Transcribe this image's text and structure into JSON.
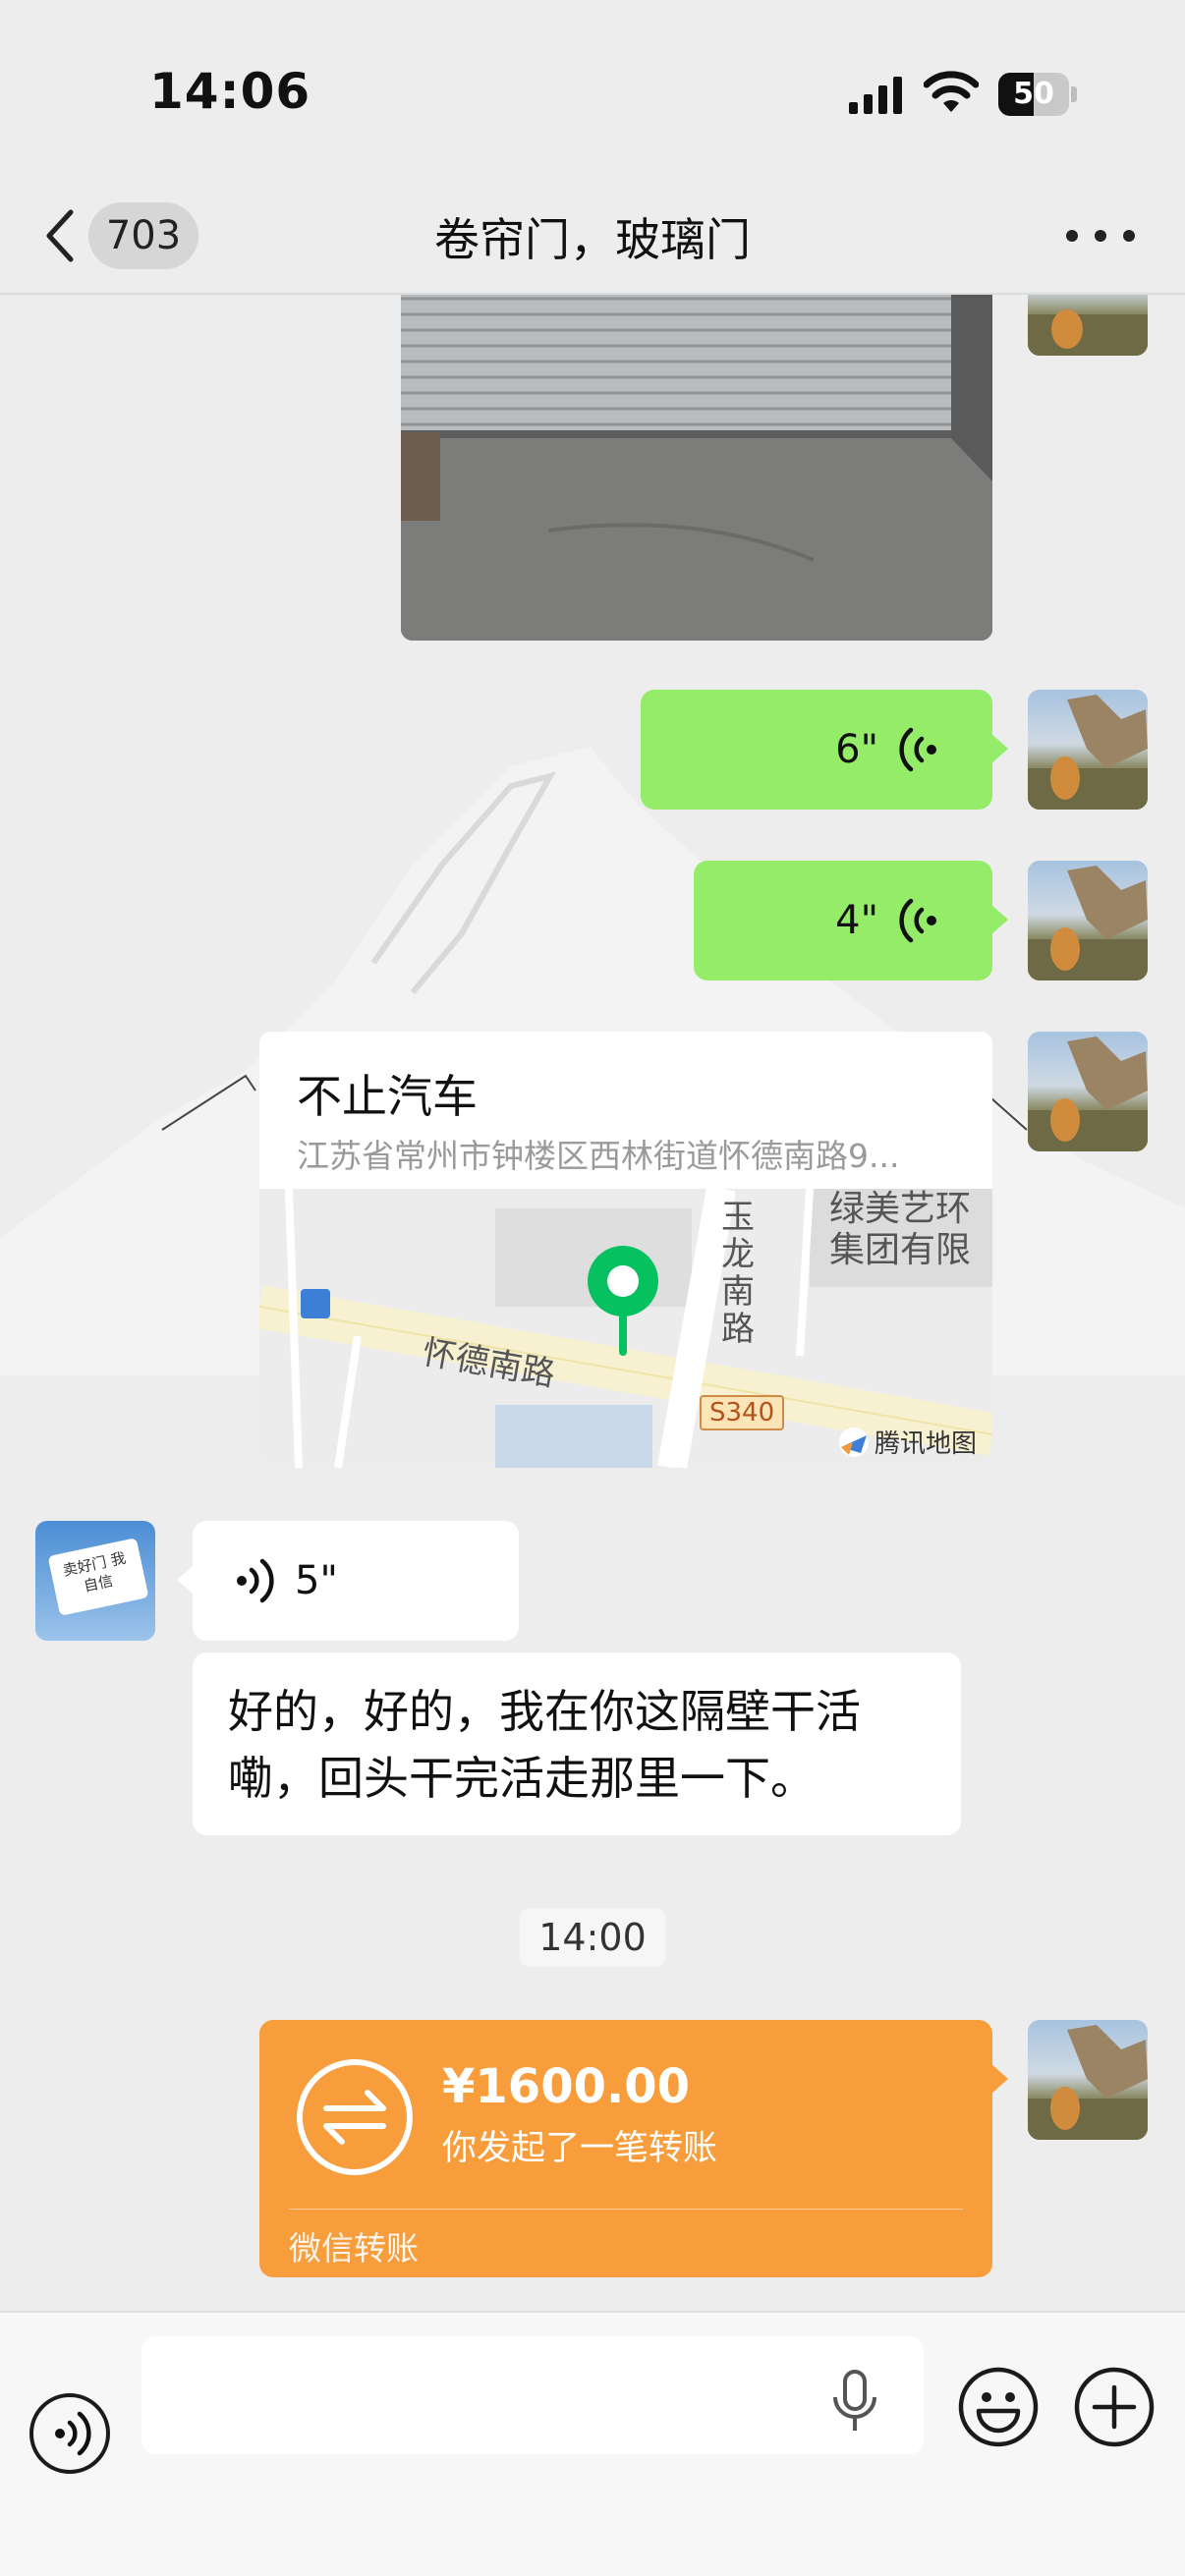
{
  "status_bar": {
    "time": "14:06",
    "battery_percent": "50",
    "battery_level": 0.5
  },
  "header": {
    "back_badge": "703",
    "title": "卷帘门，玻璃门"
  },
  "messages": [
    {
      "type": "image",
      "from": "me",
      "subject": "roller-shutter-door-photo"
    },
    {
      "type": "voice",
      "from": "me",
      "duration": "6\""
    },
    {
      "type": "voice",
      "from": "me",
      "duration": "4\""
    },
    {
      "type": "location",
      "from": "me",
      "name": "不止汽车",
      "address": "江苏省常州市钟楼区西林街道怀德南路9...",
      "map": {
        "road_main": "怀德南路",
        "road_side": "玉龙南路",
        "highway": "S340",
        "poi": "绿美艺环集团有限",
        "provider": "腾讯地图"
      }
    },
    {
      "type": "voice",
      "from": "partner",
      "duration": "5\""
    },
    {
      "type": "text",
      "from": "partner",
      "text": "好的，好的，我在你这隔壁干活嘞，回头干完活走那里一下。"
    },
    {
      "type": "time",
      "text": "14:00"
    },
    {
      "type": "transfer",
      "from": "me",
      "amount": "¥1600.00",
      "description": "你发起了一笔转账",
      "footer": "微信转账"
    }
  ],
  "partner_avatar_text": "卖好门 我自信",
  "input_bar": {
    "placeholder": ""
  },
  "colors": {
    "sent_bubble": "#95ec69",
    "transfer_card": "#f89d3c",
    "background": "#ededed"
  }
}
